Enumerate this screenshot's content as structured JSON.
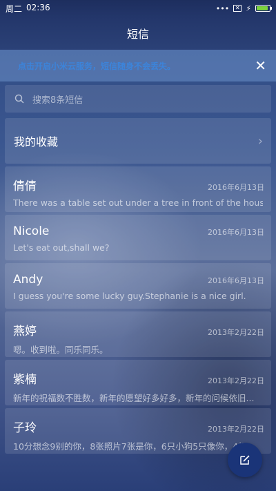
{
  "status_bar": {
    "day": "周二",
    "time": "02:36",
    "signal_dots": "•••"
  },
  "header": {
    "title": "短信"
  },
  "notice": {
    "text": "点击开启小米云服务，短信随身不会丢失。",
    "close_icon": "close-icon"
  },
  "search": {
    "placeholder": "搜索8条短信"
  },
  "favorites": {
    "label": "我的收藏"
  },
  "messages": [
    {
      "name": "倩倩",
      "date": "2016年6月13日",
      "preview": "There was a table set out under a tree in front of the hous"
    },
    {
      "name": "Nicole",
      "date": "2016年6月13日",
      "preview": "Let's eat out,shall we?"
    },
    {
      "name": "Andy",
      "date": "2016年6月13日",
      "preview": "I guess you're some lucky guy.Stephanie is a nice girl."
    },
    {
      "name": "燕婷",
      "date": "2013年2月22日",
      "preview": "嗯。收到啦。同乐同乐。"
    },
    {
      "name": "紫楠",
      "date": "2013年2月22日",
      "preview": "新年的祝福数不胜数，新年的愿望好多好多，新年的问候依旧..."
    },
    {
      "name": "子玲",
      "date": "2013年2月22日",
      "preview": "10分想念9别的你，8张照片7张是你，6只小狗5只像你，4根..."
    }
  ],
  "fab": {
    "icon": "compose-icon"
  },
  "colors": {
    "accent": "#3a86e0",
    "fab": "#1a3478",
    "battery": "#7cd23e"
  }
}
